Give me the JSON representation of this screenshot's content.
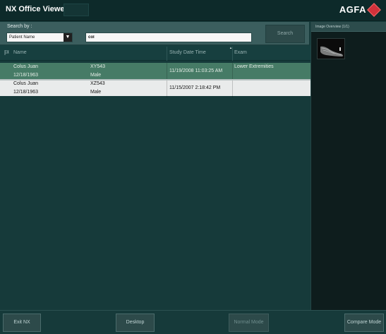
{
  "app": {
    "title": "NX Office Viewer",
    "brand": "AGFA",
    "brand_logo_icon": "agfa-diamond-logo-icon",
    "brand_color": "#d1323b"
  },
  "search": {
    "label": "Search by :",
    "select_value": "Patient Name",
    "input_value": "col",
    "button_label": "Search"
  },
  "list": {
    "columns": [
      "Name",
      "Study Date Time",
      "Exam"
    ],
    "flag_icon": "flag-icon",
    "sort_indicator": "▲",
    "rows": [
      {
        "name": "Colus Juan",
        "birthdate": "12/18/1963",
        "patient_id": "XY543",
        "sex": "Male",
        "study_datetime": "11/19/2008 11:03:25 AM",
        "exam": "Lower Extremities",
        "selected": true
      },
      {
        "name": "Colus Juan",
        "birthdate": "12/18/1963",
        "patient_id": "XZ543",
        "sex": "Male",
        "study_datetime": "11/15/2007 2:18:42 PM",
        "exam": "",
        "selected": false
      }
    ]
  },
  "preview": {
    "header": "Image Overview (1/1)",
    "thumbnail_icon": "foot-xray-thumbnail"
  },
  "footer": {
    "exit_label": "Exit NX",
    "desktop_label": "Desktop",
    "normal_mode_label": "Normal Mode",
    "compare_mode_label": "Compare Mode"
  },
  "colors": {
    "background": "#163a3a",
    "selected_row": "#467b66",
    "second_row": "#e9ebeb",
    "searchbar": "#3b5e5e"
  }
}
